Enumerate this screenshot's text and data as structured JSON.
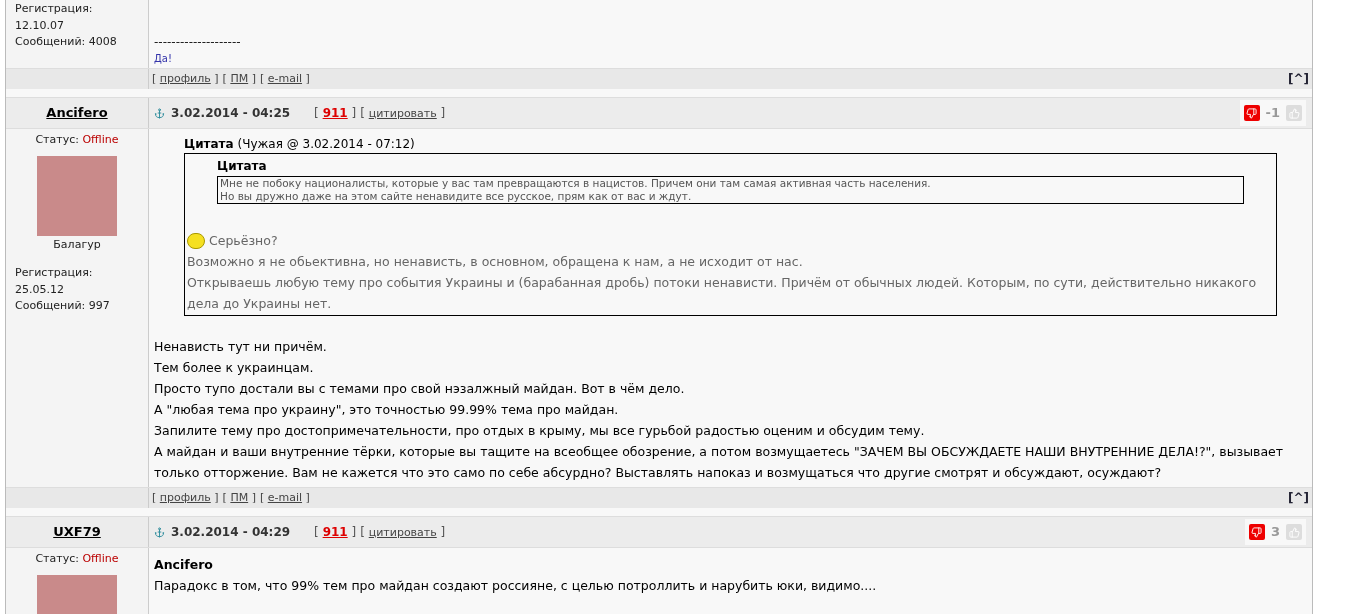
{
  "posts": [
    {
      "kind": "tail",
      "author": {
        "registration": "Регистрация: 12.10.07",
        "messages": "Сообщений: 4008"
      },
      "signature": [
        "--------------------",
        "Да!"
      ],
      "footer": {
        "links": [
          {
            "open": "[",
            "label": "профиль",
            "close": "]"
          },
          {
            "open": "[",
            "label": "ПМ",
            "close": "]"
          },
          {
            "open": "[",
            "label": "e-mail",
            "close": "]"
          }
        ],
        "top": "[^]"
      }
    },
    {
      "kind": "full",
      "author": {
        "name": "Ancifero",
        "status_label": "Статус:",
        "status": "Offline",
        "rank": "Балагур",
        "registration": "Регистрация: 25.05.12",
        "messages": "Сообщений: 997"
      },
      "date": "3.02.2014 - 04:25",
      "actions": [
        {
          "label": "911",
          "kind": "alert"
        },
        {
          "label": "цитировать",
          "kind": "normal"
        }
      ],
      "brackets": {
        "open": "[",
        "close": "]"
      },
      "rating": "-1",
      "quote": {
        "title": "**Цитата** (Чужая @ 3.02.2014 - 07:12)",
        "inner_title": "Цитата",
        "inner_lines": [
          "Мне не побоку националисты, которые у вас там превращаются в нацистов. Причем они там самая активная часть населения.",
          "Но вы дружно даже на этом сайте ненавидите все русское, прям как от вас и ждут."
        ],
        "smiley_text": "Серьёзно?",
        "lines": [
          "Возможно я не обьективна, но ненависть, в основном, обращена к нам, а не исходит от нас.",
          "Открываешь любую тему про события Украины и (барабанная дробь) потоки ненависти. Причём от обычных людей. Которым, по сути, действительно никакого дела до Украины нет."
        ]
      },
      "body": [
        "Ненависть тут ни причём.",
        "Тем более к украинцам.",
        "Просто тупо достали вы с темами про свой нэзалжный майдан. Вот в чём дело.",
        "А \"любая тема про украину\", это точностью 99.99% тема про майдан.",
        "Запилите тему про достопримечательности, про отдых в крыму, мы все гурьбой радостью оценим и обсудим тему.",
        "А майдан и ваши внутренние тёрки, которые вы тащите на всеобщее обозрение, а потом возмущаетесь \"ЗАЧЕМ ВЫ ОБСУЖДАЕТЕ НАШИ ВНУТРЕННИЕ ДЕЛА!?\", вызывает только отторжение. Вам не кажется что это само по себе абсурдно? Выставлять напоказ и возмущаться что другие смотрят и обсуждают, осуждают?"
      ],
      "footer": {
        "links": [
          {
            "open": "[",
            "label": "профиль",
            "close": "]"
          },
          {
            "open": "[",
            "label": "ПМ",
            "close": "]"
          },
          {
            "open": "[",
            "label": "e-mail",
            "close": "]"
          }
        ],
        "top": "[^]"
      }
    },
    {
      "kind": "full",
      "author": {
        "name": "UXF79",
        "status_label": "Статус:",
        "status": "Offline"
      },
      "date": "3.02.2014 - 04:29",
      "actions": [
        {
          "label": "911",
          "kind": "alert"
        },
        {
          "label": "цитировать",
          "kind": "normal"
        }
      ],
      "brackets": {
        "open": "[",
        "close": "]"
      },
      "rating": "3",
      "reply_to": "Ancifero",
      "body": [
        "Парадокс в том, что 99% тем про майдан создают россияне, с целью потроллить и нарубить юки, видимо...."
      ]
    }
  ]
}
